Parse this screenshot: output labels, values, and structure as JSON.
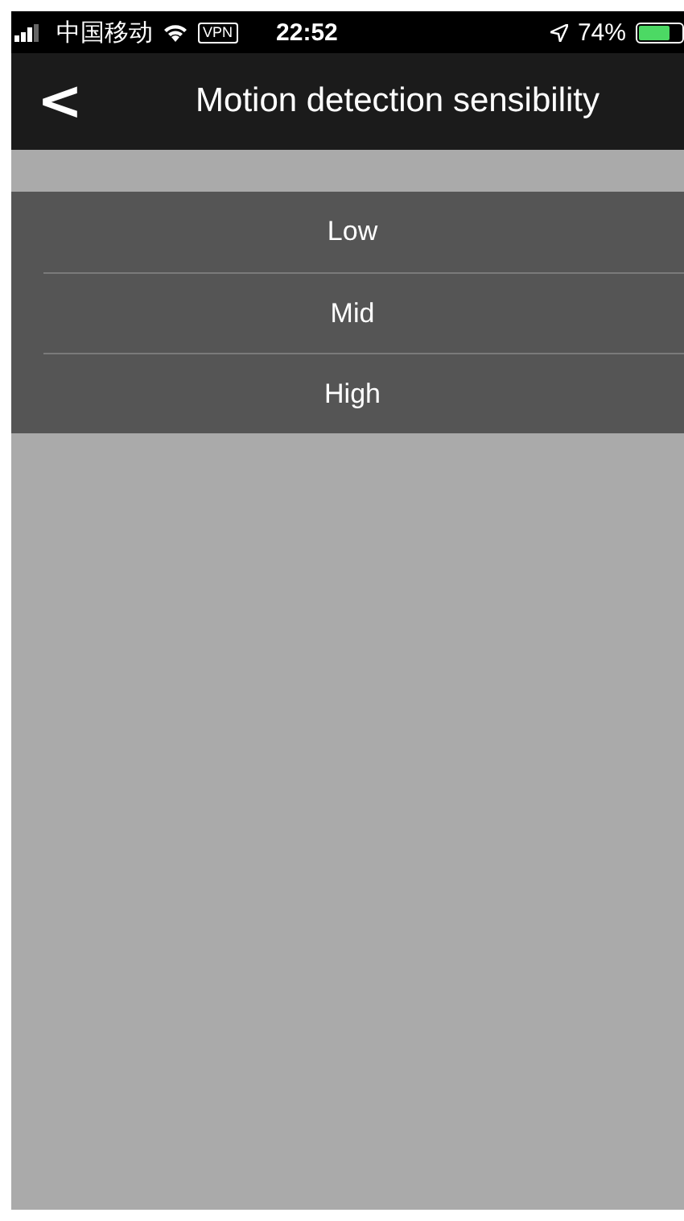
{
  "status_bar": {
    "carrier": "中国移动",
    "vpn": "VPN",
    "time": "22:52",
    "battery_percent": "74%"
  },
  "nav_bar": {
    "back": "<",
    "title": "Motion detection sensibility"
  },
  "options": [
    {
      "label": "Low"
    },
    {
      "label": "Mid"
    },
    {
      "label": "High"
    }
  ]
}
